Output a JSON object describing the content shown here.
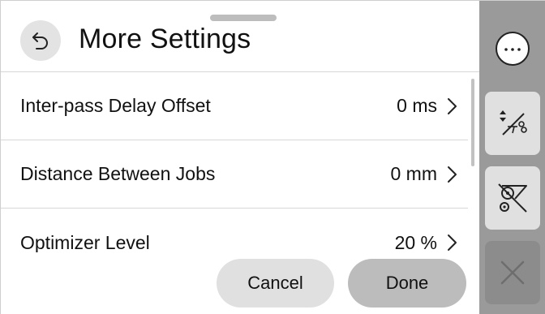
{
  "header": {
    "title": "More Settings",
    "back_icon": "back-arrow-icon"
  },
  "settings": [
    {
      "label": "Inter-pass Delay Offset",
      "value": "0 ms"
    },
    {
      "label": "Distance Between Jobs",
      "value": "0 mm"
    },
    {
      "label": "Optimizer Level",
      "value": "20 %"
    }
  ],
  "footer": {
    "cancel_label": "Cancel",
    "done_label": "Done"
  },
  "rail": {
    "items": [
      {
        "name": "more-options",
        "icon": "ellipsis-icon"
      },
      {
        "name": "cut-settings",
        "icon": "cutter-icon"
      },
      {
        "name": "media-feed",
        "icon": "media-feed-icon"
      },
      {
        "name": "close",
        "icon": "close-icon"
      }
    ]
  },
  "colors": {
    "rail_bg": "#9a9a9a",
    "button_light": "#e0e0e0",
    "done_button": "#bcbcbc",
    "close_button": "#8c8c8c"
  }
}
